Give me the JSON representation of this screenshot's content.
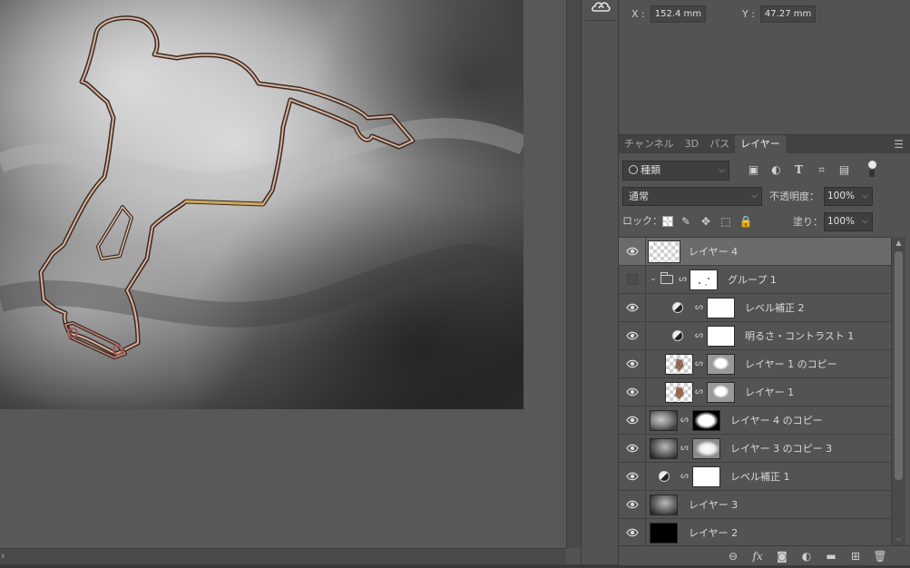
{
  "canvas": {
    "background": "#585858"
  },
  "properties": {
    "x_label": "X :",
    "x_value": "152.4 mm",
    "y_label": "Y :",
    "y_value": "47.27 mm"
  },
  "tabs": [
    {
      "label": "チャンネル",
      "active": false
    },
    {
      "label": "3D",
      "active": false
    },
    {
      "label": "パス",
      "active": false
    },
    {
      "label": "レイヤー",
      "active": true
    }
  ],
  "panel_menu_icon": "hamburger-menu-icon",
  "filter": {
    "kind_label": "種類",
    "icons": [
      "pixel-filter-icon",
      "adjustment-filter-icon",
      "type-filter-icon",
      "shape-filter-icon",
      "smart-object-filter-icon"
    ]
  },
  "blend": {
    "mode": "通常",
    "opacity_label": "不透明度：",
    "opacity_value": "100%"
  },
  "lock": {
    "label": "ロック：",
    "icons": [
      "lock-transparency-icon",
      "lock-pixels-icon",
      "lock-position-icon",
      "lock-artboard-icon",
      "lock-all-icon"
    ],
    "fill_label": "塗り：",
    "fill_value": "100%"
  },
  "layers": [
    {
      "name": "レイヤー 4",
      "visible": true,
      "selected": true
    },
    {
      "name": "グループ 1",
      "visible": false,
      "group": true,
      "expanded": true
    },
    {
      "name": "レベル補正 2",
      "visible": true,
      "adjustment": true
    },
    {
      "name": "明るさ・コントラスト 1",
      "visible": true,
      "adjustment": true
    },
    {
      "name": "レイヤー 1 のコピー",
      "visible": true
    },
    {
      "name": "レイヤー 1",
      "visible": true
    },
    {
      "name": "レイヤー 4 のコピー",
      "visible": true
    },
    {
      "name": "レイヤー 3 のコピー 3",
      "visible": true
    },
    {
      "name": "レベル補正 1",
      "visible": true,
      "adjustment": true
    },
    {
      "name": "レイヤー 3",
      "visible": true
    },
    {
      "name": "レイヤー 2",
      "visible": true
    }
  ],
  "footer_icons": [
    "link-layers-icon",
    "fx-icon",
    "add-mask-icon",
    "new-adjustment-icon",
    "new-group-icon",
    "new-layer-icon",
    "trash-icon"
  ],
  "colors": {
    "selected_row": "#6b6b6b",
    "panel_bg": "#535353",
    "outline_warm": "#9a6a4a"
  }
}
